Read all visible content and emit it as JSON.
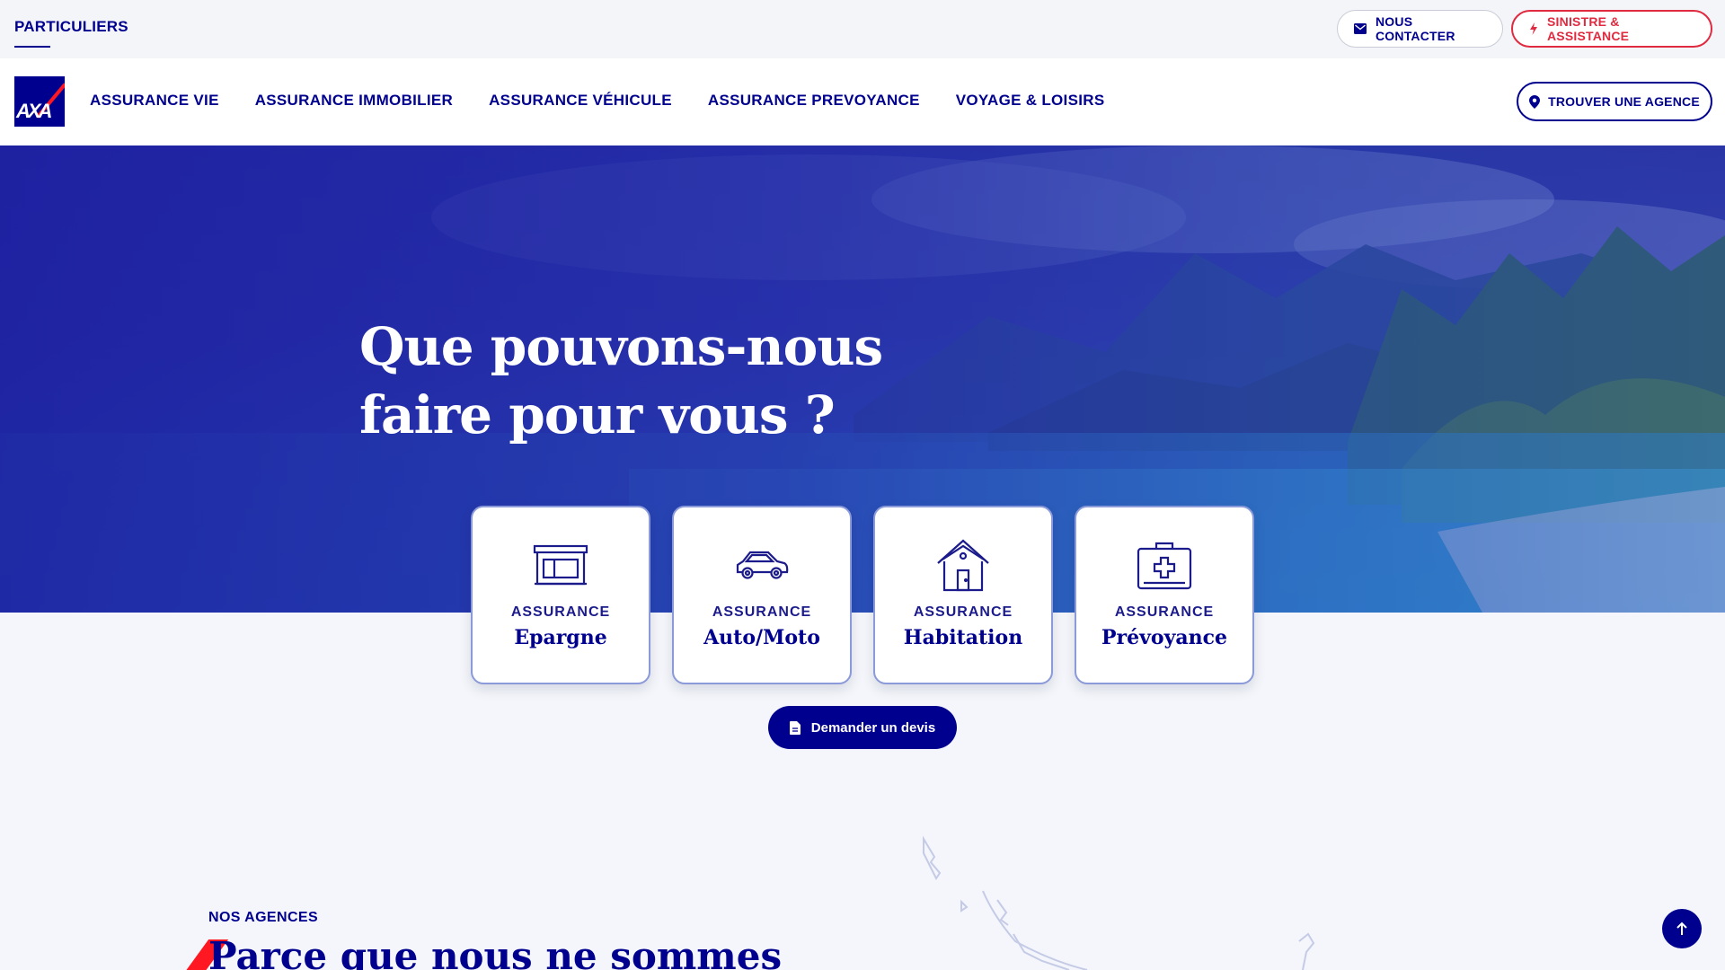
{
  "topbar": {
    "segment": "PARTICULIERS",
    "contact_label": "NOUS CONTACTER",
    "sinistre_label": "SINISTRE & ASSISTANCE"
  },
  "navbar": {
    "logo_text": "AXA",
    "links": [
      "ASSURANCE VIE",
      "ASSURANCE IMMOBILIER",
      "ASSURANCE VÉHICULE",
      "ASSURANCE PREVOYANCE",
      "VOYAGE & LOISIRS"
    ],
    "agency_label": "TROUVER UNE AGENCE"
  },
  "hero": {
    "title": "Que pouvons-nous faire pour vous ?"
  },
  "cards": [
    {
      "pre": "ASSURANCE",
      "title": "Epargne",
      "icon": "storefront-icon"
    },
    {
      "pre": "ASSURANCE",
      "title": "Auto/Moto",
      "icon": "car-icon"
    },
    {
      "pre": "ASSURANCE",
      "title": "Habitation",
      "icon": "house-icon"
    },
    {
      "pre": "ASSURANCE",
      "title": "Prévoyance",
      "icon": "medical-kit-icon"
    }
  ],
  "devis": {
    "label": "Demander un devis"
  },
  "agences": {
    "label": "NOS AGENCES",
    "title": "Parce que nous ne sommes"
  },
  "colors": {
    "brand_blue": "#00008f",
    "brand_red": "#ff1721",
    "alert_red": "#e02a3f"
  }
}
